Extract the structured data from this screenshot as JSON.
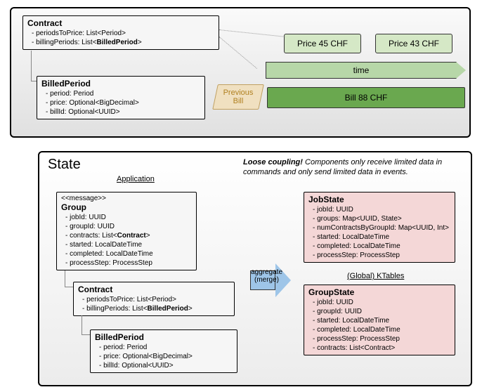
{
  "top": {
    "contract": {
      "title": "Contract",
      "fields": [
        "periodsToPrice: List<Period>",
        "billingPeriods: List<BilledPeriod>"
      ]
    },
    "billedPeriod": {
      "title": "BilledPeriod",
      "fields": [
        "period: Period",
        "price: Optional<BigDecimal>",
        "billId: Optional<UUID>"
      ]
    },
    "price1": "Price 45 CHF",
    "price2": "Price 43 CHF",
    "timeLabel": "time",
    "prevBill": "Previous Bill",
    "bill": "Bill 88 CHF"
  },
  "bottom": {
    "stateTitle": "State",
    "appHeading": "Application",
    "ktablesHeading": "(Global) KTables",
    "note": "Loose coupling! Components only receive limited data in commands and only send limited data in events.",
    "noteBold": "Loose coupling!",
    "noteRest": " Components only receive limited data in commands and only send limited data in events.",
    "group": {
      "stereo": "<<message>>",
      "title": "Group",
      "fields": [
        "jobId: UUID",
        "groupId: UUID",
        "contracts: List<Contract>",
        "started: LocalDateTime",
        "completed: LocalDateTime",
        "processStep: ProcessStep"
      ]
    },
    "contract": {
      "title": "Contract",
      "fields": [
        "periodsToPrice: List<Period>",
        "billingPeriods: List<BilledPeriod>"
      ]
    },
    "billedPeriod": {
      "title": "BilledPeriod",
      "fields": [
        "period: Period",
        "price: Optional<BigDecimal>",
        "billId: Optional<UUID>"
      ]
    },
    "aggregate": "aggregate (merge)",
    "jobState": {
      "title": "JobState",
      "fields": [
        "jobId: UUID",
        "groups: Map<UUID, State>",
        "numContractsByGroupId: Map<UUID, Int>",
        "started: LocalDateTime",
        "completed: LocalDateTime",
        "processStep: ProcessStep"
      ]
    },
    "groupState": {
      "title": "GroupState",
      "fields": [
        "jobId: UUID",
        "groupId: UUID",
        "started: LocalDateTime",
        "completed: LocalDateTime",
        "processStep: ProcessStep",
        "contracts: List<Contract>"
      ]
    }
  }
}
